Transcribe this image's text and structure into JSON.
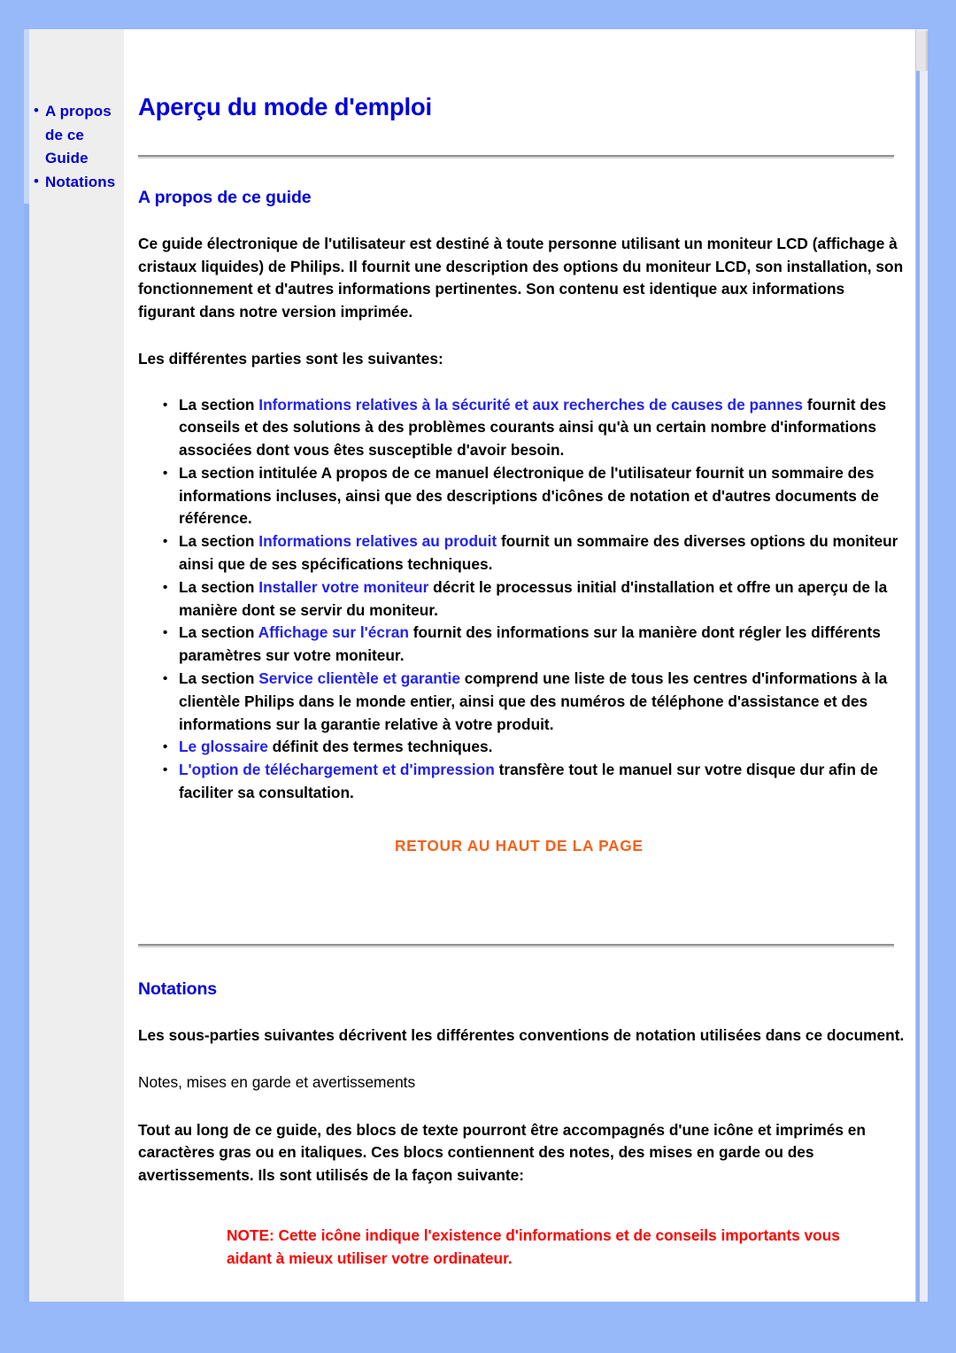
{
  "theme": {
    "background": "#97b8f9",
    "page_background": "#ffffff",
    "sidebar_background": "#eeeeee",
    "heading_color": "#0000dd",
    "link_color": "#2222ee",
    "backtotop_color": "#f4611a",
    "note_color": "#ff0000"
  },
  "sidebar": {
    "items": [
      {
        "label": "A propos de ce Guide"
      },
      {
        "label": "Notations"
      }
    ]
  },
  "document": {
    "title": "Aperçu du mode d'emploi",
    "sections": {
      "apropos": {
        "heading": "A propos de ce guide",
        "intro": "Ce guide électronique de l'utilisateur est destiné à toute personne utilisant un moniteur LCD (affichage à cristaux liquides) de Philips. Il fournit une description des options du moniteur LCD, son installation, son fonctionnement et d'autres informations pertinentes. Son contenu est identique aux informations figurant dans notre version imprimée.",
        "lead_in": "Les différentes parties sont les suivantes:",
        "bullets": [
          {
            "pre": "La section ",
            "link": "Informations relatives à la sécurité et aux recherches de causes de pannes",
            "post": " fournit des conseils et des solutions à des problèmes courants ainsi qu'à un certain nombre d'informations associées dont vous êtes susceptible d'avoir besoin."
          },
          {
            "pre": "La section intitulée A propos de ce manuel électronique de l'utilisateur fournit un sommaire des informations incluses, ainsi que des descriptions d'icônes de notation et d'autres documents de référence.",
            "link": "",
            "post": ""
          },
          {
            "pre": "La section ",
            "link": "Informations relatives au produit",
            "post": " fournit un sommaire des diverses options du moniteur ainsi que de ses spécifications techniques."
          },
          {
            "pre": "La section ",
            "link": "Installer votre moniteur",
            "post": " décrit le processus initial d'installation et offre un aperçu de la manière dont se servir du moniteur."
          },
          {
            "pre": "La section ",
            "link": "Affichage sur l'écran",
            "post": " fournit des informations sur la manière dont régler les différents paramètres sur votre moniteur."
          },
          {
            "pre": "La section ",
            "link": "Service clientèle et garantie",
            "post": " comprend une liste de tous les centres d'informations à la clientèle Philips dans le monde entier, ainsi que des numéros de téléphone d'assistance et des informations sur la garantie relative à votre produit."
          },
          {
            "pre": "",
            "link": "Le glossaire",
            "post": " définit des termes techniques."
          },
          {
            "pre": "",
            "link": "L'option de téléchargement et d'impression",
            "post": " transfère tout le manuel sur votre disque dur afin de faciliter sa consultation."
          }
        ],
        "back_to_top": "RETOUR AU HAUT DE LA PAGE"
      },
      "notations": {
        "heading": "Notations",
        "intro": "Les sous-parties suivantes décrivent les différentes conventions de notation utilisées dans ce document.",
        "subtitle": "Notes, mises en garde et avertissements",
        "body": "Tout au long de ce guide, des blocs de texte pourront être accompagnés d'une icône et imprimés en caractères gras ou en italiques. Ces blocs contiennent des notes, des mises en garde ou des avertissements. Ils sont utilisés de la façon suivante:",
        "note": "NOTE: Cette icône indique l'existence d'informations et de conseils importants vous aidant à mieux utiliser votre ordinateur."
      }
    }
  }
}
